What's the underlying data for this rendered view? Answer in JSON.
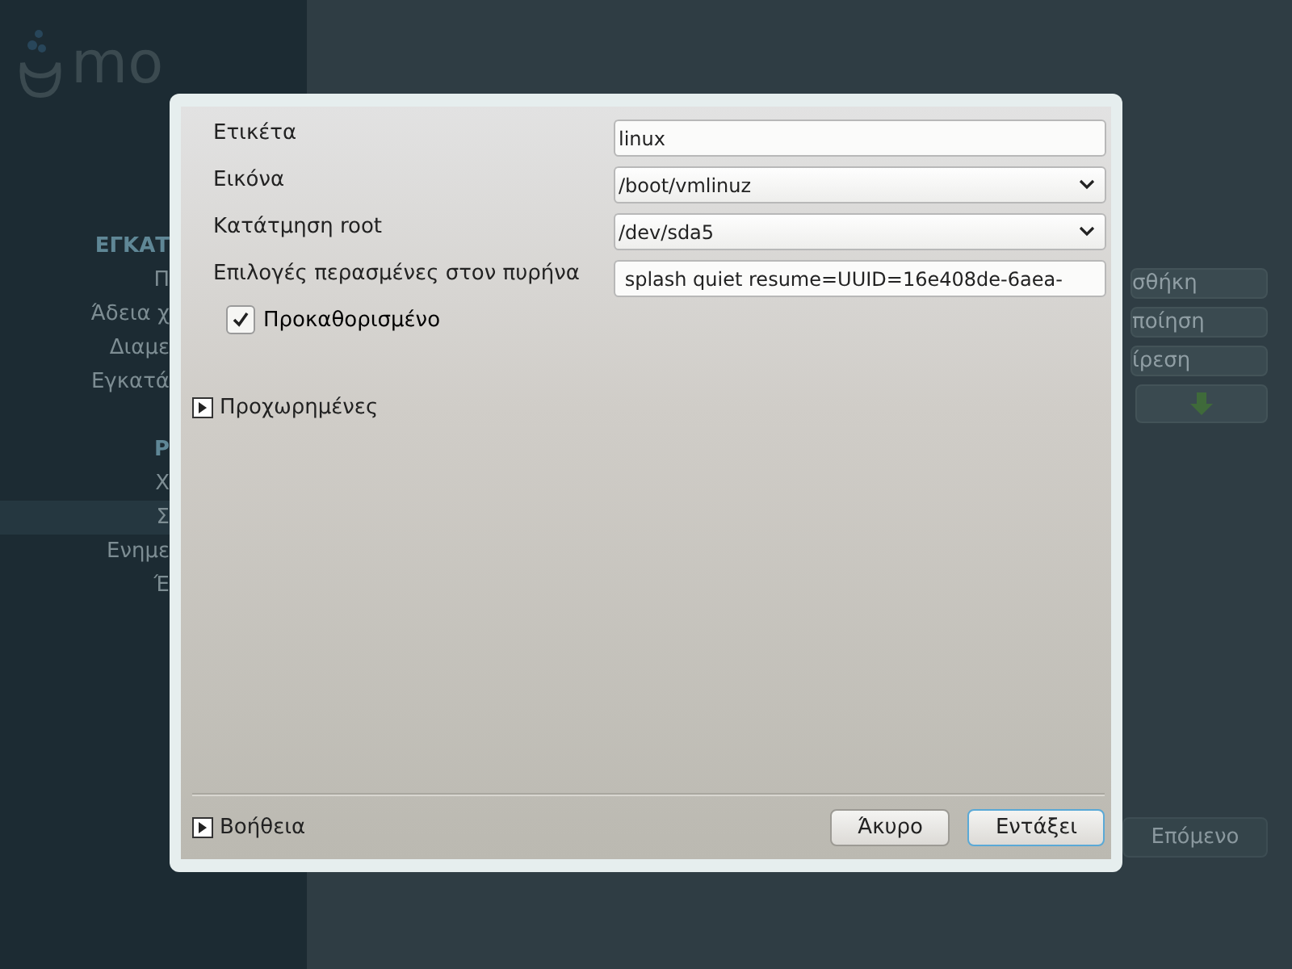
{
  "background": {
    "logo_text": "mo",
    "sidebar": {
      "items": [
        {
          "label": "ΕΓΚΑΤ",
          "kind": "heading",
          "selected": false
        },
        {
          "label": "Π",
          "kind": "step",
          "selected": false
        },
        {
          "label": "Άδεια χ",
          "kind": "step",
          "selected": false
        },
        {
          "label": "Διαμε",
          "kind": "step",
          "selected": false
        },
        {
          "label": "Εγκατά",
          "kind": "step",
          "selected": false
        },
        {
          "label": "Ρ",
          "kind": "heading",
          "selected": false
        },
        {
          "label": "Χ",
          "kind": "step",
          "selected": false
        },
        {
          "label": "Σ",
          "kind": "step",
          "selected": true
        },
        {
          "label": "Ενημε",
          "kind": "step",
          "selected": false
        },
        {
          "label": "Έ",
          "kind": "step",
          "selected": false
        }
      ]
    },
    "side_buttons": [
      "σθήκη",
      "ποίηση",
      "ίρεση"
    ],
    "next_button": "Επόμενο"
  },
  "dialog": {
    "fields": [
      {
        "label": "Ετικέτα",
        "kind": "text",
        "value": "linux"
      },
      {
        "label": "Εικόνα",
        "kind": "combo",
        "value": "/boot/vmlinuz"
      },
      {
        "label": "Κατάτμηση root",
        "kind": "combo",
        "value": "/dev/sda5"
      },
      {
        "label": "Επιλογές περασμένες στον πυρήνα",
        "kind": "text",
        "value": " splash quiet resume=UUID=16e408de-6aea-"
      }
    ],
    "default_checkbox": {
      "label": "Προκαθορισμένο",
      "checked": true
    },
    "advanced": {
      "label": "Προχωρημένες",
      "expanded": false
    },
    "help": {
      "label": "Βοήθεια",
      "expanded": false
    },
    "buttons": [
      "Άκυρο",
      "Εντάξει"
    ]
  }
}
